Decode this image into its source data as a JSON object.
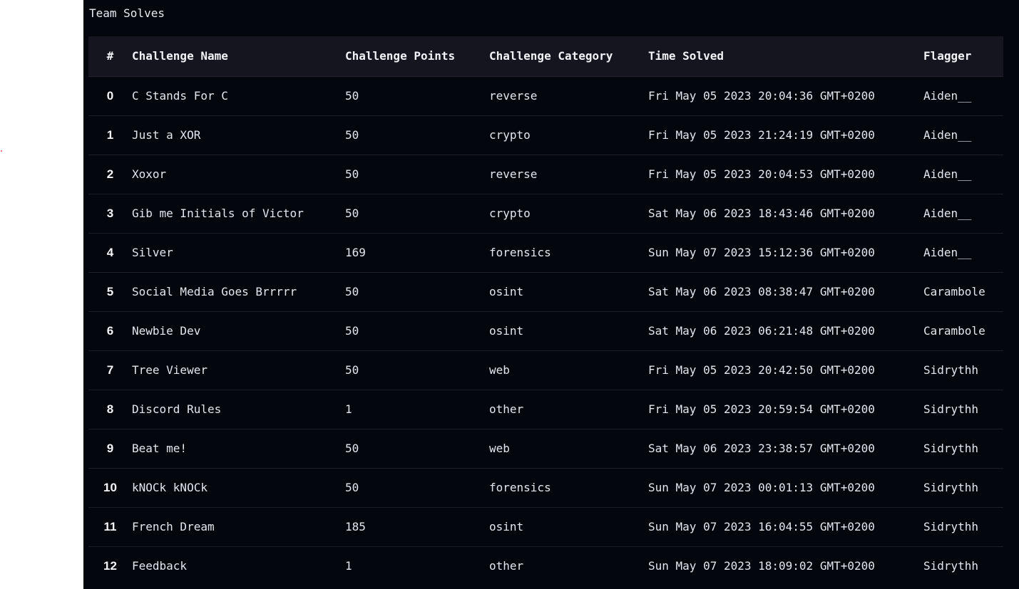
{
  "panel": {
    "title": "Team Solves"
  },
  "table": {
    "headers": {
      "index": "#",
      "name": "Challenge Name",
      "points": "Challenge Points",
      "category": "Challenge Category",
      "time": "Time Solved",
      "flagger": "Flagger"
    },
    "rows": [
      {
        "index": "0",
        "name": "C Stands For C",
        "points": "50",
        "category": "reverse",
        "time": "Fri May 05 2023 20:04:36 GMT+0200",
        "flagger": "Aiden__"
      },
      {
        "index": "1",
        "name": "Just a XOR",
        "points": "50",
        "category": "crypto",
        "time": "Fri May 05 2023 21:24:19 GMT+0200",
        "flagger": "Aiden__"
      },
      {
        "index": "2",
        "name": "Xoxor",
        "points": "50",
        "category": "reverse",
        "time": "Fri May 05 2023 20:04:53 GMT+0200",
        "flagger": "Aiden__"
      },
      {
        "index": "3",
        "name": "Gib me Initials of Victor",
        "points": "50",
        "category": "crypto",
        "time": "Sat May 06 2023 18:43:46 GMT+0200",
        "flagger": "Aiden__"
      },
      {
        "index": "4",
        "name": "Silver",
        "points": "169",
        "category": "forensics",
        "time": "Sun May 07 2023 15:12:36 GMT+0200",
        "flagger": "Aiden__"
      },
      {
        "index": "5",
        "name": "Social Media Goes Brrrrr",
        "points": "50",
        "category": "osint",
        "time": "Sat May 06 2023 08:38:47 GMT+0200",
        "flagger": "Carambole"
      },
      {
        "index": "6",
        "name": "Newbie Dev",
        "points": "50",
        "category": "osint",
        "time": "Sat May 06 2023 06:21:48 GMT+0200",
        "flagger": "Carambole"
      },
      {
        "index": "7",
        "name": "Tree Viewer",
        "points": "50",
        "category": "web",
        "time": "Fri May 05 2023 20:42:50 GMT+0200",
        "flagger": "Sidrythh"
      },
      {
        "index": "8",
        "name": "Discord Rules",
        "points": "1",
        "category": "other",
        "time": "Fri May 05 2023 20:59:54 GMT+0200",
        "flagger": "Sidrythh"
      },
      {
        "index": "9",
        "name": "Beat me!",
        "points": "50",
        "category": "web",
        "time": "Sat May 06 2023 23:38:57 GMT+0200",
        "flagger": "Sidrythh"
      },
      {
        "index": "10",
        "name": "kNOCk kNOCk",
        "points": "50",
        "category": "forensics",
        "time": "Sun May 07 2023 00:01:13 GMT+0200",
        "flagger": "Sidrythh"
      },
      {
        "index": "11",
        "name": "French Dream",
        "points": "185",
        "category": "osint",
        "time": "Sun May 07 2023 16:04:55 GMT+0200",
        "flagger": "Sidrythh"
      },
      {
        "index": "12",
        "name": "Feedback",
        "points": "1",
        "category": "other",
        "time": "Sun May 07 2023 18:09:02 GMT+0200",
        "flagger": "Sidrythh"
      }
    ]
  }
}
